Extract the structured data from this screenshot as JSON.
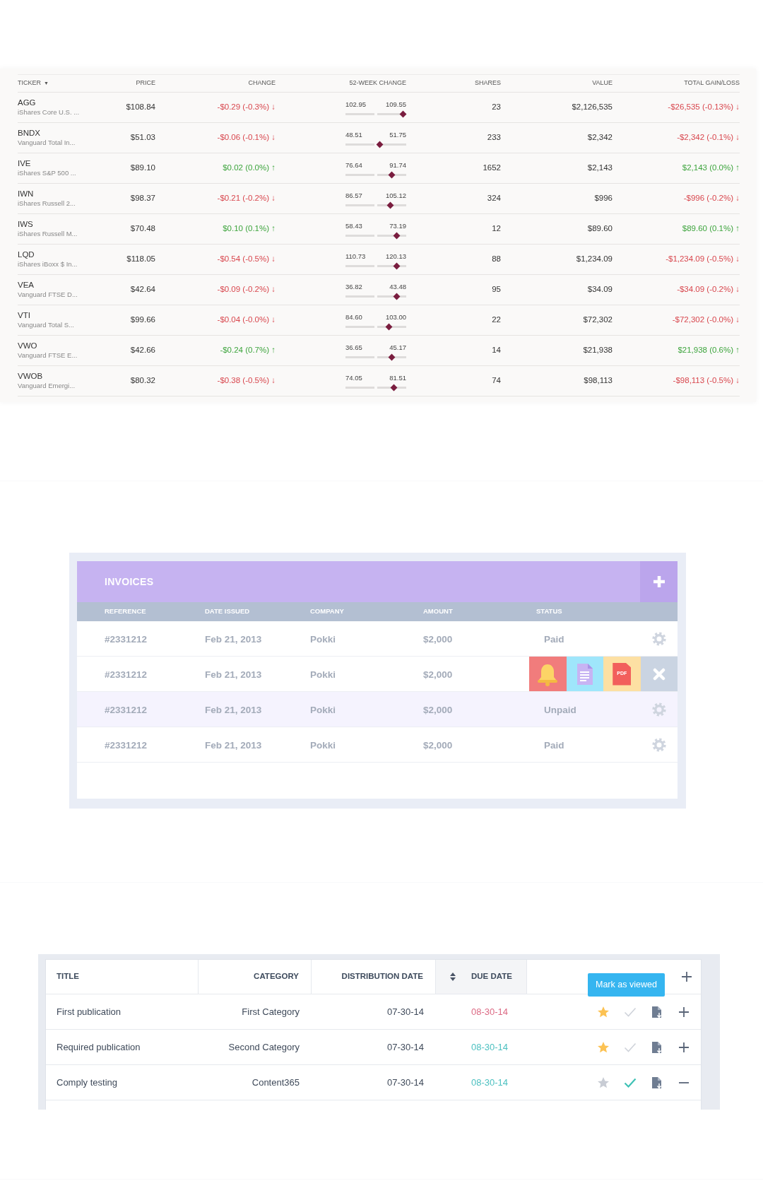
{
  "holdings": {
    "columns": [
      "TICKER",
      "PRICE",
      "CHANGE",
      "52-WEEK CHANGE",
      "SHARES",
      "VALUE",
      "TOTAL GAIN/LOSS"
    ],
    "sort_indicator": "▼",
    "rows": [
      {
        "ticker": "AGG",
        "name": "iShares Core U.S. ...",
        "price": "$108.84",
        "change": "-$0.29 (-0.3%) ↓",
        "change_up": false,
        "low": "102.95",
        "high": "109.55",
        "level": 0.95,
        "shares": "23",
        "value": "$2,126,535",
        "gain": "-$26,535 (-0.13%) ↓",
        "gain_up": false
      },
      {
        "ticker": "BNDX",
        "name": "Vanguard Total In...",
        "price": "$51.03",
        "change": "-$0.06 (-0.1%) ↓",
        "change_up": false,
        "low": "48.51",
        "high": "51.75",
        "level": 0.56,
        "shares": "233",
        "value": "$2,342",
        "gain": "-$2,342 (-0.1%) ↓",
        "gain_up": false
      },
      {
        "ticker": "IVE",
        "name": "iShares S&P 500 ...",
        "price": "$89.10",
        "change": "$0.02 (0.0%) ↑",
        "change_up": true,
        "low": "76.64",
        "high": "91.74",
        "level": 0.76,
        "shares": "1652",
        "value": "$2,143",
        "gain": "$2,143 (0.0%) ↑",
        "gain_up": true
      },
      {
        "ticker": "IWN",
        "name": "iShares Russell 2...",
        "price": "$98.37",
        "change": "-$0.21 (-0.2%) ↓",
        "change_up": false,
        "low": "86.57",
        "high": "105.12",
        "level": 0.74,
        "shares": "324",
        "value": "$996",
        "gain": "-$996 (-0.2%) ↓",
        "gain_up": false
      },
      {
        "ticker": "IWS",
        "name": "iShares Russell M...",
        "price": "$70.48",
        "change": "$0.10 (0.1%) ↑",
        "change_up": true,
        "low": "58.43",
        "high": "73.19",
        "level": 0.84,
        "shares": "12",
        "value": "$89.60",
        "gain": "$89.60 (0.1%) ↑",
        "gain_up": true
      },
      {
        "ticker": "LQD",
        "name": "iShares iBoxx $ In...",
        "price": "$118.05",
        "change": "-$0.54 (-0.5%) ↓",
        "change_up": false,
        "low": "110.73",
        "high": "120.13",
        "level": 0.84,
        "shares": "88",
        "value": "$1,234.09",
        "gain": "-$1,234.09 (-0.5%) ↓",
        "gain_up": false
      },
      {
        "ticker": "VEA",
        "name": "Vanguard FTSE D...",
        "price": "$42.64",
        "change": "-$0.09 (-0.2%) ↓",
        "change_up": false,
        "low": "36.82",
        "high": "43.48",
        "level": 0.84,
        "shares": "95",
        "value": "$34.09",
        "gain": "-$34.09 (-0.2%) ↓",
        "gain_up": false
      },
      {
        "ticker": "VTI",
        "name": "Vanguard Total S...",
        "price": "$99.66",
        "change": "-$0.04 (-0.0%) ↓",
        "change_up": false,
        "low": "84.60",
        "high": "103.00",
        "level": 0.72,
        "shares": "22",
        "value": "$72,302",
        "gain": "-$72,302 (-0.0%) ↓",
        "gain_up": false
      },
      {
        "ticker": "VWO",
        "name": "Vanguard FTSE E...",
        "price": "$42.66",
        "change": "-$0.24 (0.7%) ↑",
        "change_up": true,
        "low": "36.65",
        "high": "45.17",
        "level": 0.76,
        "shares": "14",
        "value": "$21,938",
        "gain": "$21,938 (0.6%) ↑",
        "gain_up": true
      },
      {
        "ticker": "VWOB",
        "name": "Vanguard Emergi...",
        "price": "$80.32",
        "change": "-$0.38 (-0.5%) ↓",
        "change_up": false,
        "low": "74.05",
        "high": "81.51",
        "level": 0.8,
        "shares": "74",
        "value": "$98,113",
        "gain": "-$98,113 (-0.5%) ↓",
        "gain_up": false
      }
    ]
  },
  "invoices": {
    "title": "INVOICES",
    "columns": [
      "REFERENCE",
      "DATE ISSUED",
      "COMPANY",
      "AMOUNT",
      "STATUS"
    ],
    "rows": [
      {
        "kind": "status",
        "highlighted": false,
        "reference": "#2331212",
        "date": "Feb 21, 2013",
        "company": "Pokki",
        "amount": "$2,000",
        "status": "Paid"
      },
      {
        "kind": "actions",
        "highlighted": false,
        "reference": "#2331212",
        "date": "Feb 21, 2013",
        "company": "Pokki",
        "amount": "$2,000",
        "actions": [
          {
            "kind": "bell",
            "color": "#f17c7c"
          },
          {
            "kind": "document",
            "color": "#9fe6fb"
          },
          {
            "kind": "pdf",
            "label": "PDF",
            "color": "#fde0a3"
          },
          {
            "kind": "close",
            "color": "#cad4e2"
          }
        ]
      },
      {
        "kind": "status",
        "highlighted": true,
        "reference": "#2331212",
        "date": "Feb 21, 2013",
        "company": "Pokki",
        "amount": "$2,000",
        "status": "Unpaid"
      },
      {
        "kind": "status",
        "highlighted": false,
        "reference": "#2331212",
        "date": "Feb 21, 2013",
        "company": "Pokki",
        "amount": "$2,000",
        "status": "Paid"
      }
    ]
  },
  "publications": {
    "columns": [
      "TITLE",
      "CATEGORY",
      "DISTRIBUTION DATE",
      "DUE DATE"
    ],
    "tooltip": "Mark as viewed",
    "rows": [
      {
        "title": "First publication",
        "category": "First Category",
        "distribution_date": "07-30-14",
        "due_date": "08-30-14",
        "overdue": true,
        "starred": true,
        "viewed": false,
        "expanded": false
      },
      {
        "title": "Required publication",
        "category": "Second Category",
        "distribution_date": "07-30-14",
        "due_date": "08-30-14",
        "overdue": false,
        "starred": true,
        "viewed": false,
        "expanded": false
      },
      {
        "title": "Comply testing",
        "category": "Content365",
        "distribution_date": "07-30-14",
        "due_date": "08-30-14",
        "overdue": false,
        "starred": false,
        "viewed": true,
        "expanded": true
      }
    ]
  }
}
